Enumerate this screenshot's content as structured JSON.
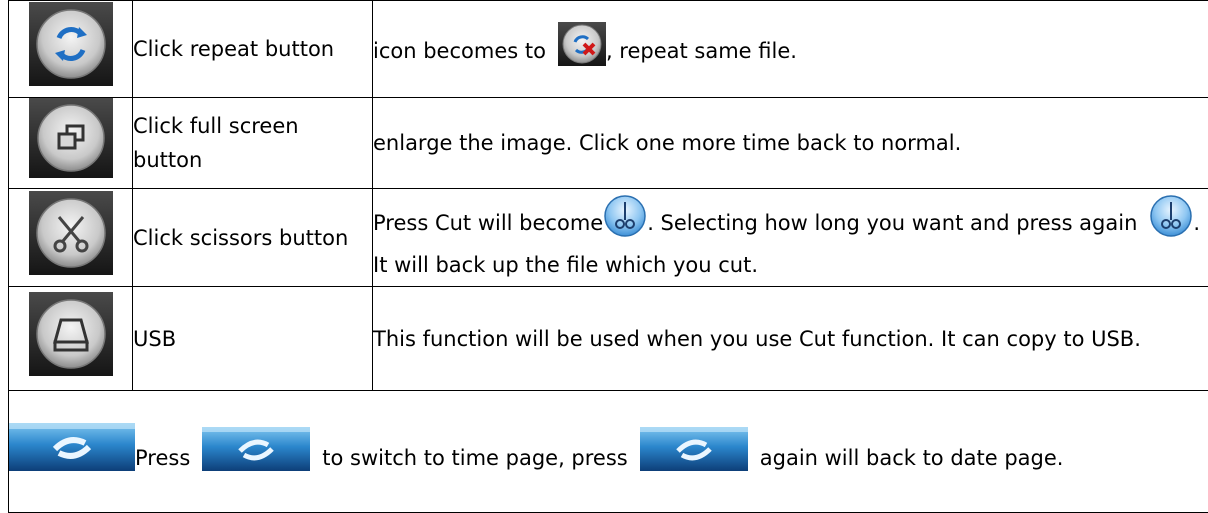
{
  "rows": [
    {
      "icon": "repeat-icon",
      "label": "Click repeat button",
      "desc_part1": "icon becomes to",
      "desc_icon": "repeat-off-icon",
      "desc_part2": ", repeat same file."
    },
    {
      "icon": "full-screen-icon",
      "label": "Click full screen button",
      "desc": "enlarge the image. Click one more time back to normal."
    },
    {
      "icon": "scissors-icon",
      "label": "Click scissors button",
      "desc_part1": "Press Cut will become",
      "desc_icon": "cut-active-icon",
      "desc_part2": ". Selecting how long you want and press again",
      "desc_icon2": "cut-active-icon",
      "desc_part3": ". It will back up the file which you cut."
    },
    {
      "icon": "usb-icon",
      "label": "USB",
      "desc": "This function will be used when you use Cut function. It can copy to USB."
    }
  ],
  "footer": {
    "icon": "switch-page-icon",
    "part1": "Press",
    "part2": "to switch to time page, press",
    "part3": "again will back to date page."
  },
  "colors": {
    "icon_bg_dark": "#2a2a2a",
    "icon_ring": "#c8c8c8",
    "repeat_blue": "#1f6fc4",
    "cut_blue": "#5da8e6",
    "switch_bar_blue": "#1c6fb8"
  }
}
